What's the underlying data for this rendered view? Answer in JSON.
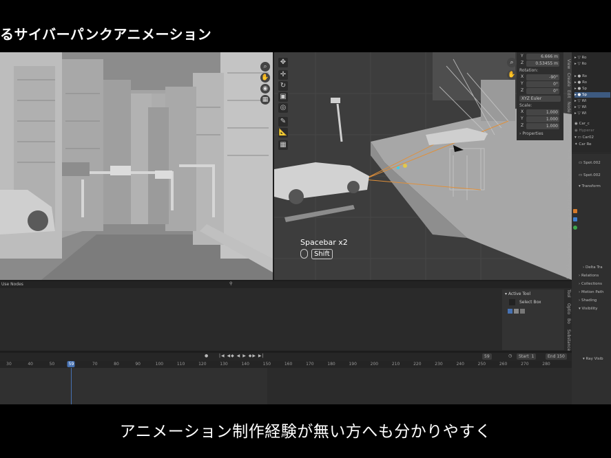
{
  "caption": {
    "title": "るサイバーパンクアニメーション",
    "subtitle": "アニメーション制作経験が無い方へも分かりやすく"
  },
  "viewport": {
    "shortcut_text": "Spacebar x2",
    "shortcut_key": "Shift"
  },
  "npanel": {
    "location_y": "6.666 m",
    "location_z": "0.53455 m",
    "rotation_label": "Rotation:",
    "rot_x": "-90°",
    "rot_y": "0°",
    "rot_z": "0°",
    "rotation_mode": "XYZ Euler",
    "scale_label": "Scale:",
    "scale_x": "1.000",
    "scale_y": "1.000",
    "scale_z": "1.000",
    "properties_label": "Properties",
    "tabs": [
      "View",
      "Create",
      "Edit",
      "Node",
      "Atmosphere",
      "Scatter",
      "HardOps",
      "Substance 3 Art",
      "Screencast Keys",
      "polygoniq"
    ]
  },
  "outliner": {
    "items": [
      "Ro",
      "Ro",
      "Ro",
      "Ro",
      "Sp",
      "Sp",
      "Wi",
      "Wi",
      "Wi",
      "Car_c",
      "Hyperar",
      "Car02",
      "Car Re"
    ],
    "selected_index": 5
  },
  "properties": {
    "object_name": "Spot.002",
    "data_name": "Spot.002",
    "sections": [
      "Transform",
      "Delta Tra",
      "Relations",
      "Collections",
      "Motion Path",
      "Shading",
      "Visibility",
      "Ray Visib"
    ]
  },
  "editor": {
    "header_label": "Use Nodes",
    "tool_panel_title": "Active Tool",
    "tool_name": "Select Box",
    "side_tabs": [
      "Tool",
      "Optio",
      "Bo",
      "Substance"
    ]
  },
  "timeline": {
    "current_frame": "59",
    "frame_field": "59",
    "start_label": "Start",
    "start_value": "1",
    "end_label": "End",
    "end_value": "150",
    "ticks": [
      "30",
      "40",
      "50",
      "59",
      "70",
      "80",
      "90",
      "100",
      "110",
      "120",
      "130",
      "140",
      "150",
      "160",
      "170",
      "180",
      "190",
      "200",
      "210",
      "220",
      "230",
      "240",
      "250",
      "260",
      "270",
      "280"
    ]
  },
  "colors": {
    "accent": "#4772b3",
    "background": "#000000"
  }
}
